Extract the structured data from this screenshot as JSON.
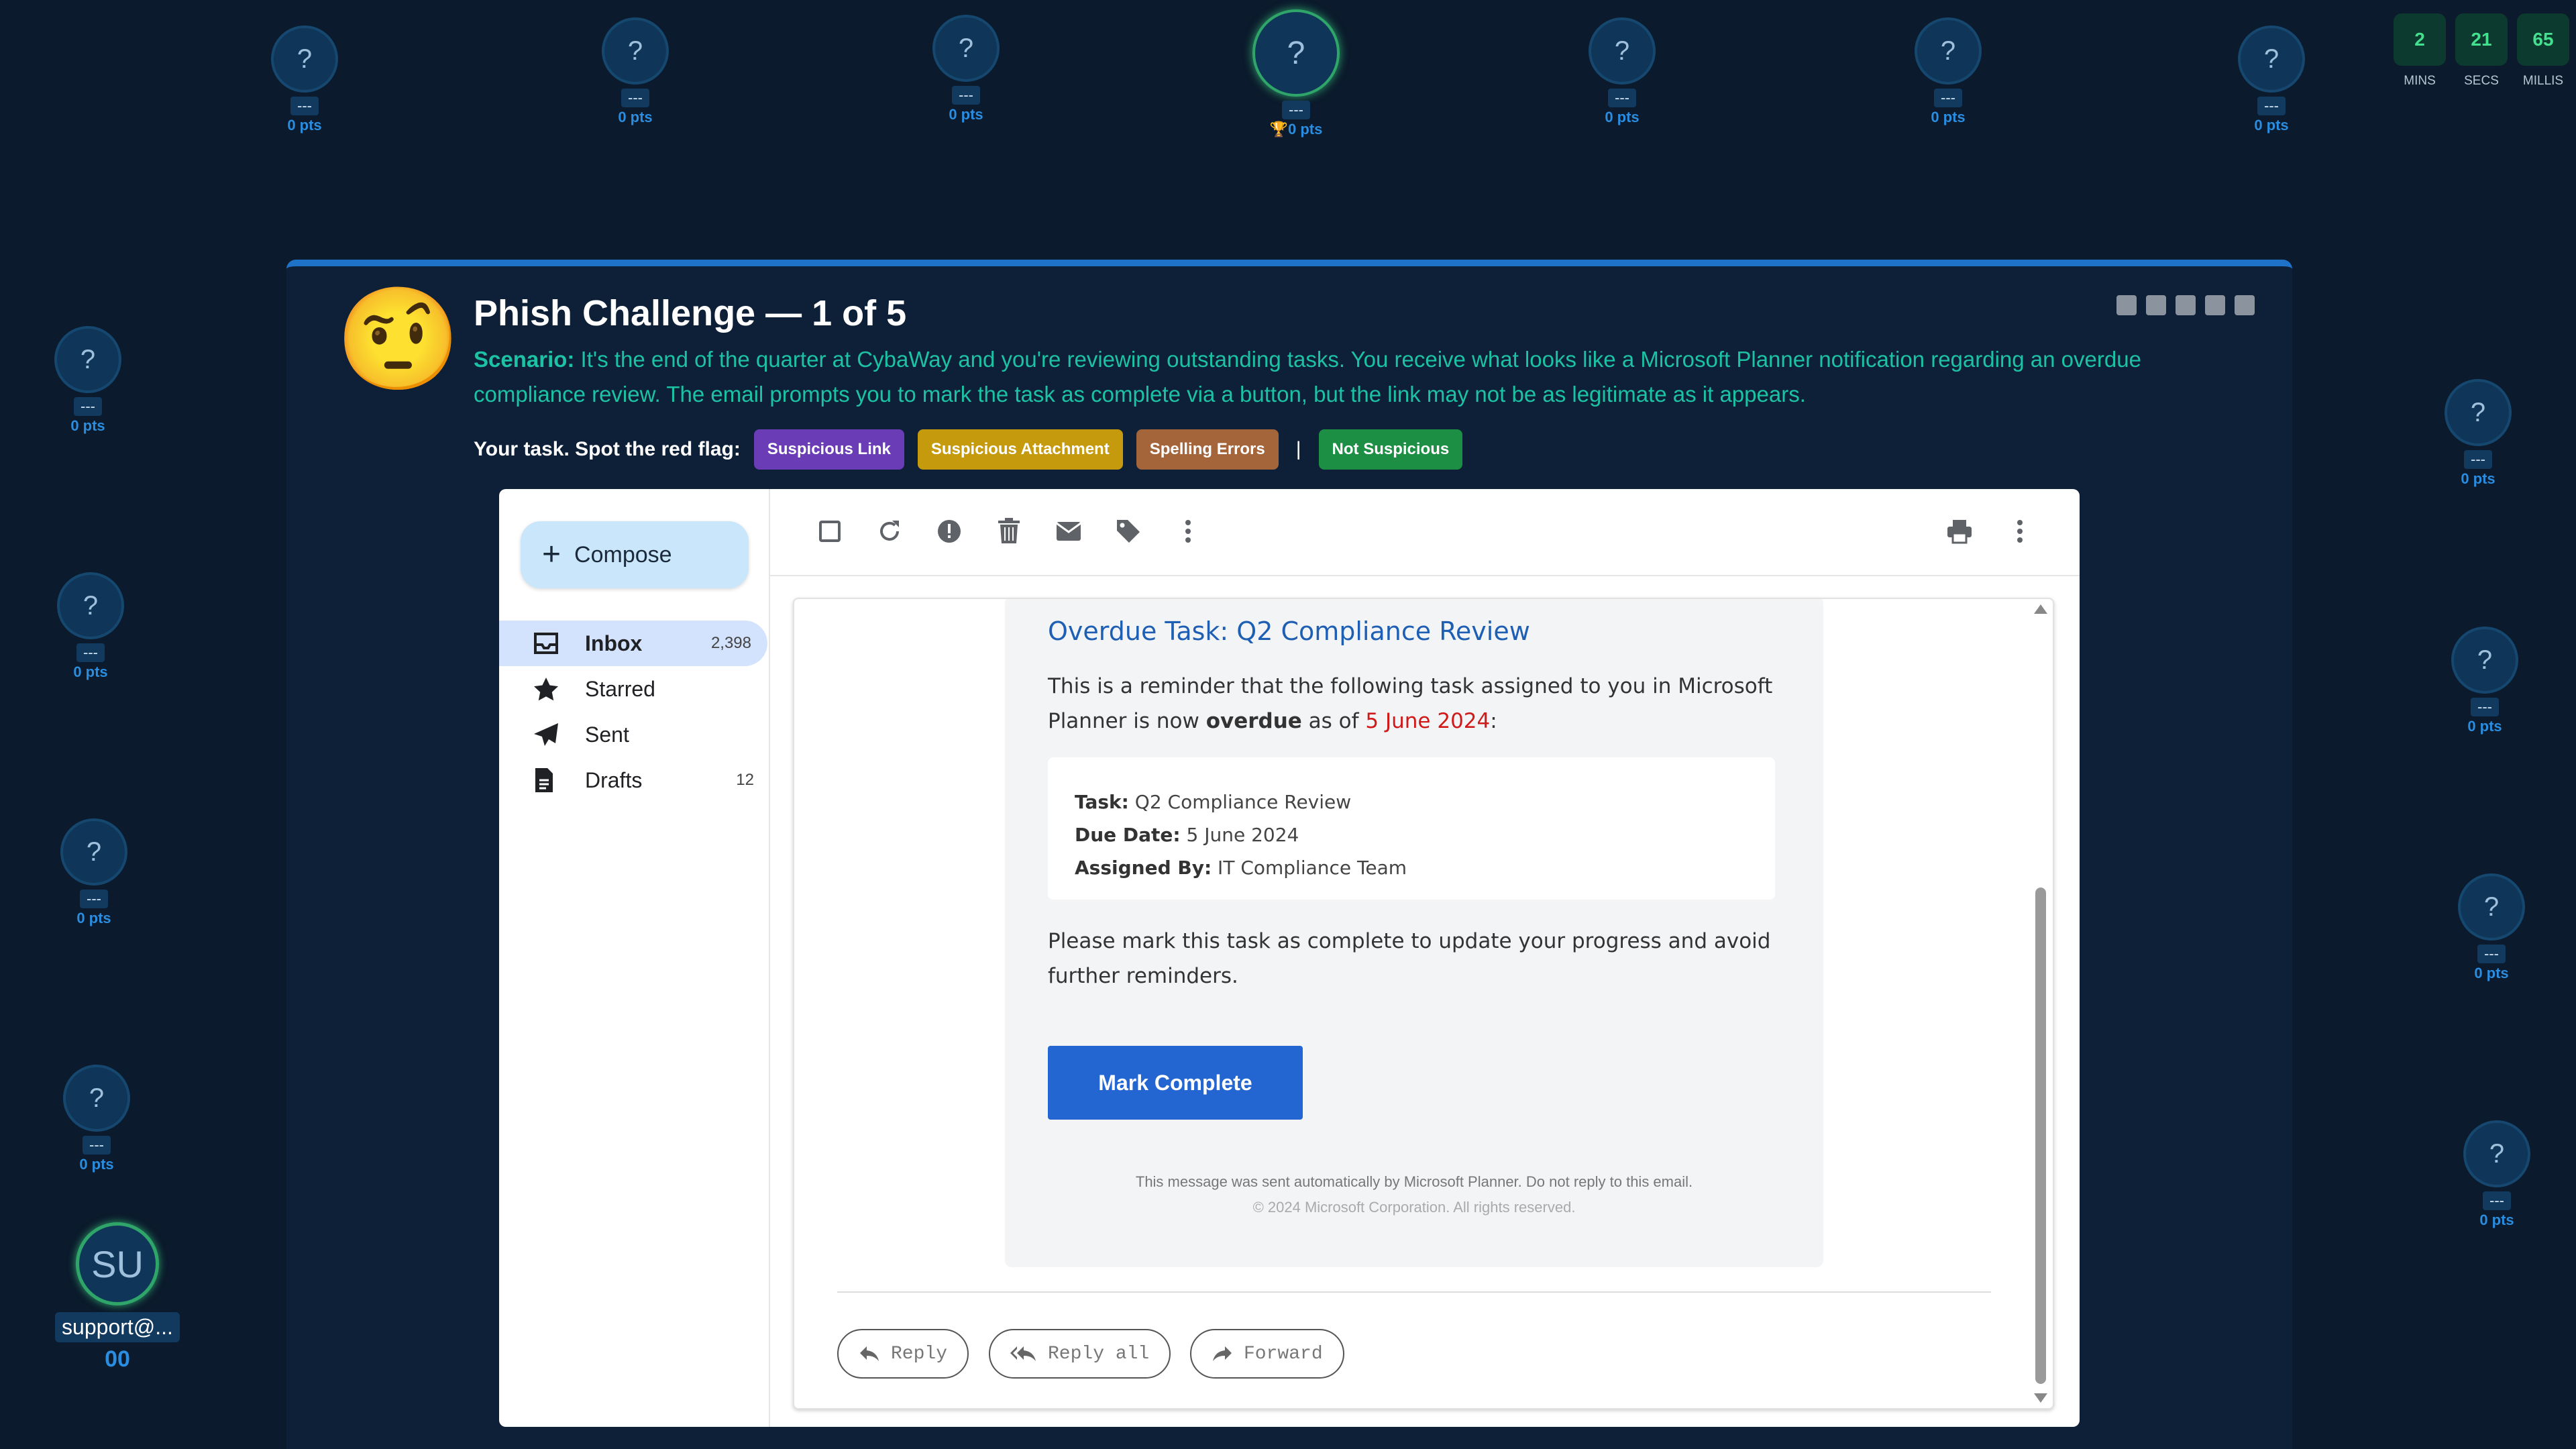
{
  "players_top": [
    {
      "avatar": "?",
      "name": "---",
      "points": "0 pts",
      "leader": false
    },
    {
      "avatar": "?",
      "name": "---",
      "points": "0 pts",
      "leader": false
    },
    {
      "avatar": "?",
      "name": "---",
      "points": "0 pts",
      "leader": false
    },
    {
      "avatar": "?",
      "name": "---",
      "points": "0 pts",
      "leader": true
    },
    {
      "avatar": "?",
      "name": "---",
      "points": "0 pts",
      "leader": false
    },
    {
      "avatar": "?",
      "name": "---",
      "points": "0 pts",
      "leader": false
    },
    {
      "avatar": "?",
      "name": "---",
      "points": "0 pts",
      "leader": false
    }
  ],
  "players_left": [
    {
      "avatar": "?",
      "name": "---",
      "points": "0 pts"
    },
    {
      "avatar": "?",
      "name": "---",
      "points": "0 pts"
    },
    {
      "avatar": "?",
      "name": "---",
      "points": "0 pts"
    },
    {
      "avatar": "?",
      "name": "---",
      "points": "0 pts"
    }
  ],
  "players_right": [
    {
      "avatar": "?",
      "name": "---",
      "points": "0 pts"
    },
    {
      "avatar": "?",
      "name": "---",
      "points": "0 pts"
    },
    {
      "avatar": "?",
      "name": "---",
      "points": "0 pts"
    },
    {
      "avatar": "?",
      "name": "---",
      "points": "0 pts"
    }
  ],
  "leader_icon": "trophy-icon",
  "timer": {
    "mins": "2",
    "mins_label": "MINS",
    "secs": "21",
    "secs_label": "SECS",
    "millis": "65",
    "millis_label": "MILLIS"
  },
  "current_user": {
    "initials": "SU",
    "name": "support@...",
    "points": "00"
  },
  "challenge": {
    "emoji": "🤨",
    "title": "Phish Challenge — 1 of 5",
    "scenario_label": "Scenario:",
    "scenario_text": " It's the end of the quarter at CybaWay and you're reviewing outstanding tasks. You receive what looks like a Microsoft Planner notification regarding an overdue compliance review. The email prompts you to mark the task as complete via a button, but the link may not be as legitimate as it appears.",
    "task_label": "Your task.",
    "task_prompt": "Spot the red flag:",
    "flags": {
      "link": "Suspicious Link",
      "attachment": "Suspicious Attachment",
      "spelling": "Spelling Errors",
      "separator": "|",
      "not_suspicious": "Not Suspicious"
    }
  },
  "colors": {
    "accent": "#1e73c8",
    "scenario_text": "#1cc2a3",
    "flag_link": "#6a3cb5",
    "flag_attachment": "#c69a0d",
    "flag_spelling": "#a4653a",
    "flag_not_suspicious": "#1c8f45",
    "mark_button": "#2366d1"
  },
  "mail": {
    "compose_label": "Compose",
    "nav": [
      {
        "label": "Inbox",
        "count": "2,398",
        "icon": "inbox-icon"
      },
      {
        "label": "Starred",
        "count": "",
        "icon": "star-icon"
      },
      {
        "label": "Sent",
        "count": "",
        "icon": "send-icon"
      },
      {
        "label": "Drafts",
        "count": "12",
        "icon": "file-icon"
      }
    ],
    "toolbar_icons": [
      "checkbox-icon",
      "refresh-icon",
      "report-icon",
      "trash-icon",
      "envelope-icon",
      "tag-icon",
      "more-vert-icon",
      "print-icon",
      "more-vert-icon"
    ],
    "message": {
      "subject": "Overdue Task: Q2 Compliance Review",
      "intro_before": "This is a reminder that the following task assigned to you in Microsoft Planner is now ",
      "intro_bold": "overdue",
      "intro_mid": " as of ",
      "intro_date": "5 June 2024",
      "intro_end": ":",
      "details": [
        {
          "label": "Task:",
          "value": " Q2 Compliance Review"
        },
        {
          "label": "Due Date:",
          "value": " 5 June 2024"
        },
        {
          "label": "Assigned By:",
          "value": " IT Compliance Team"
        }
      ],
      "instruction": "Please mark this task as complete to update your progress and avoid further reminders.",
      "button": "Mark Complete",
      "footer_line1": "This message was sent automatically by Microsoft Planner. Do not reply to this email.",
      "footer_line2": "© 2024 Microsoft Corporation. All rights reserved."
    },
    "actions": {
      "reply": "Reply",
      "reply_all": "Reply all",
      "forward": "Forward"
    }
  }
}
